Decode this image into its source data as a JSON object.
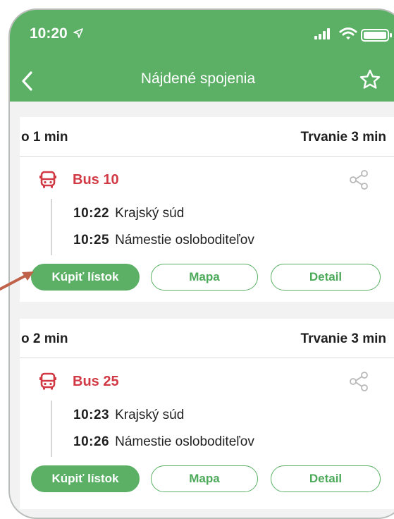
{
  "status_bar": {
    "time": "10:20"
  },
  "nav": {
    "title": "Nájdené spojenia"
  },
  "colors": {
    "accent": "#5bb065",
    "bus": "#d13a44",
    "arrow": "#c0614a"
  },
  "connections": [
    {
      "departs_in": "o 1 min",
      "duration": "Trvanie 3 min",
      "line": "Bus 10",
      "stops": [
        {
          "time": "10:22",
          "name": "Krajský súd"
        },
        {
          "time": "10:25",
          "name": "Námestie osloboditeľov"
        }
      ],
      "buttons": {
        "buy": "Kúpiť lístok",
        "map": "Mapa",
        "detail": "Detail"
      }
    },
    {
      "departs_in": "o 2 min",
      "duration": "Trvanie 3 min",
      "line": "Bus 25",
      "stops": [
        {
          "time": "10:23",
          "name": "Krajský súd"
        },
        {
          "time": "10:26",
          "name": "Námestie osloboditeľov"
        }
      ],
      "buttons": {
        "buy": "Kúpiť lístok",
        "map": "Mapa",
        "detail": "Detail"
      }
    }
  ]
}
